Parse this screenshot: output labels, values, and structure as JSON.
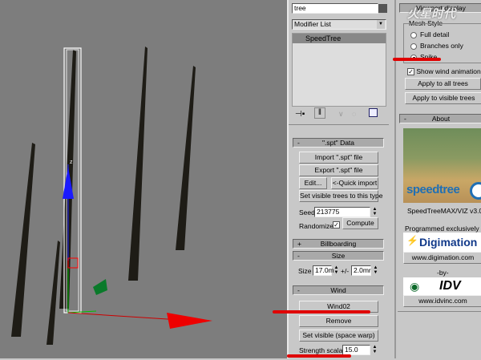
{
  "modifier": {
    "name_field": "tree",
    "modifier_list": "Modifier List",
    "stack_items": [
      "SpeedTree"
    ]
  },
  "viewport_display": {
    "title": "Viewport display",
    "group": "Mesh Style",
    "options": [
      "Full detail",
      "Branches only",
      "Spike"
    ],
    "selected": "Spike",
    "show_wind_label": "Show wind animation",
    "show_wind_checked": true,
    "apply_all": "Apply to all trees",
    "apply_visible": "Apply to visible trees"
  },
  "about": {
    "title": "About",
    "logo_text": "speedtree",
    "version": "SpeedTreeMAX/VIZ v3.0",
    "programmed": "Programmed exclusively for",
    "digimation_logo": "Digimation",
    "digimation_url": "www.digimation.com",
    "by": "-by-",
    "idv_logo": "IDV",
    "idv_url": "www.idvinc.com"
  },
  "spt": {
    "title": "\".spt\" Data",
    "import": "Import \".spt\" file",
    "export": "Export \".spt\" file",
    "edit": "Edit...",
    "quick_import": "<-Quick import",
    "set_visible": "Set visible trees to this type",
    "seed_label": "Seed",
    "seed_value": "213775",
    "randomize_label": "Randomize",
    "randomize_checked": true,
    "compute": "Compute"
  },
  "billboarding": {
    "title": "Billboarding"
  },
  "size": {
    "title": "Size",
    "size_label": "Size",
    "size_value": "17.0m",
    "variance_label": "+/-",
    "variance_value": "2.0mr"
  },
  "wind": {
    "title": "Wind",
    "wind_object": "Wind02",
    "remove": "Remove",
    "set_visible": "Set visible (space warp)",
    "strength_label": "Strength scalar",
    "strength_value": "15.0"
  },
  "watermark": "火星时代",
  "gizmo_label": "z",
  "colors": {
    "viewport": "#7d7d7d",
    "panel": "#c8c8c8",
    "annotation": "#e00000"
  }
}
